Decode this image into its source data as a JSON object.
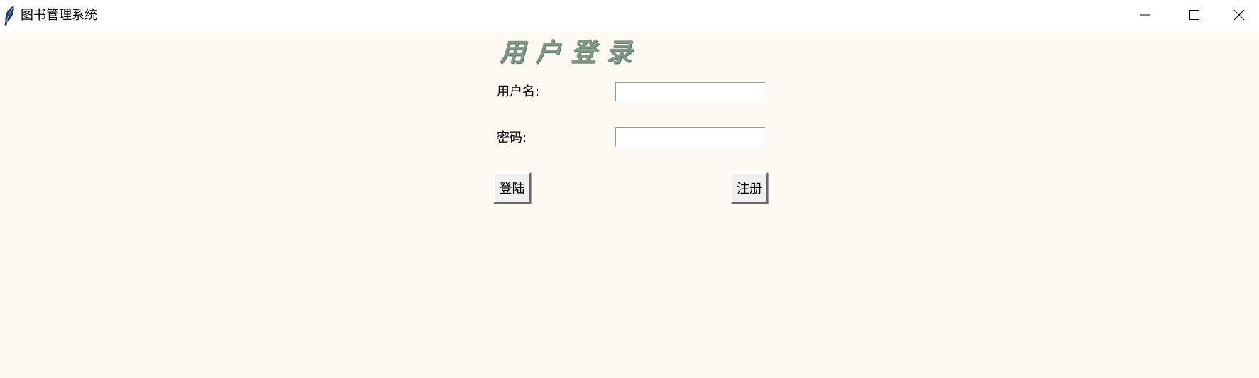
{
  "window": {
    "title": "图书管理系统",
    "app_icon": "feather-icon",
    "controls": {
      "minimize": "minimize-icon",
      "maximize": "maximize-icon",
      "close": "close-icon"
    }
  },
  "login": {
    "heading": "用户登录",
    "username_label": "用户名:",
    "username_value": "",
    "password_label": "密码:",
    "password_value": "",
    "login_button": "登陆",
    "register_button": "注册"
  },
  "colors": {
    "background": "#fff9f3",
    "heading": "#7d9a86"
  }
}
